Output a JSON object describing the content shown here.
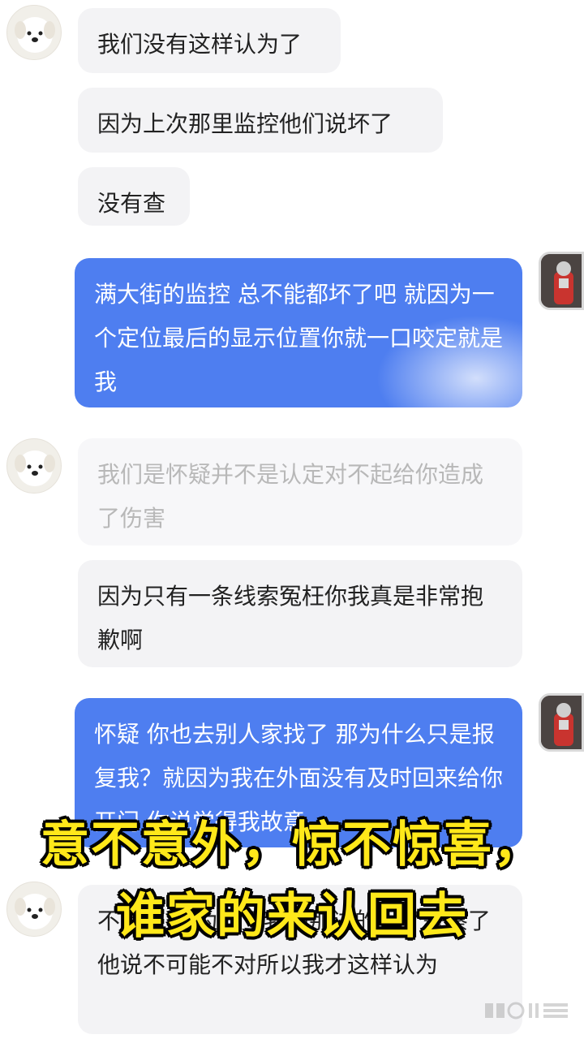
{
  "chat": {
    "messages": [
      {
        "side": "left",
        "text": "我们没有这样认为了"
      },
      {
        "side": "left",
        "text": "因为上次那里监控他们说坏了"
      },
      {
        "side": "left",
        "text": "没有查"
      },
      {
        "side": "right",
        "text": "满大街的监控 总不能都坏了吧 就因为一个定位最后的显示位置你就一口咬定就是我"
      },
      {
        "side": "left",
        "text": "我们是怀疑并不是认定对不起给你造成了伤害"
      },
      {
        "side": "left",
        "text": "因为只有一条线索冤枉你我真是非常抱歉啊"
      },
      {
        "side": "right",
        "text": "怀疑 你也去别人家找了 那为什么只是报复我？就因为我在外面没有及时回来给你开门 你说觉得我故意"
      },
      {
        "side": "left",
        "text": "不是的 因为问了我们那边的一个警察了他说不可能不对所以我才这样认为"
      }
    ]
  },
  "overlay": {
    "line1": "意不意外，惊不惊喜，",
    "line2": "谁家的来认回去"
  },
  "icons": {
    "peer_avatar": "dog-avatar-icon",
    "self_avatar": "ultraman-avatar-icon",
    "watermark": "watermark-icon"
  },
  "colors": {
    "self_bubble": "#4e7ef0",
    "peer_bubble": "#f3f3f5",
    "caption": "#ffe81a"
  }
}
